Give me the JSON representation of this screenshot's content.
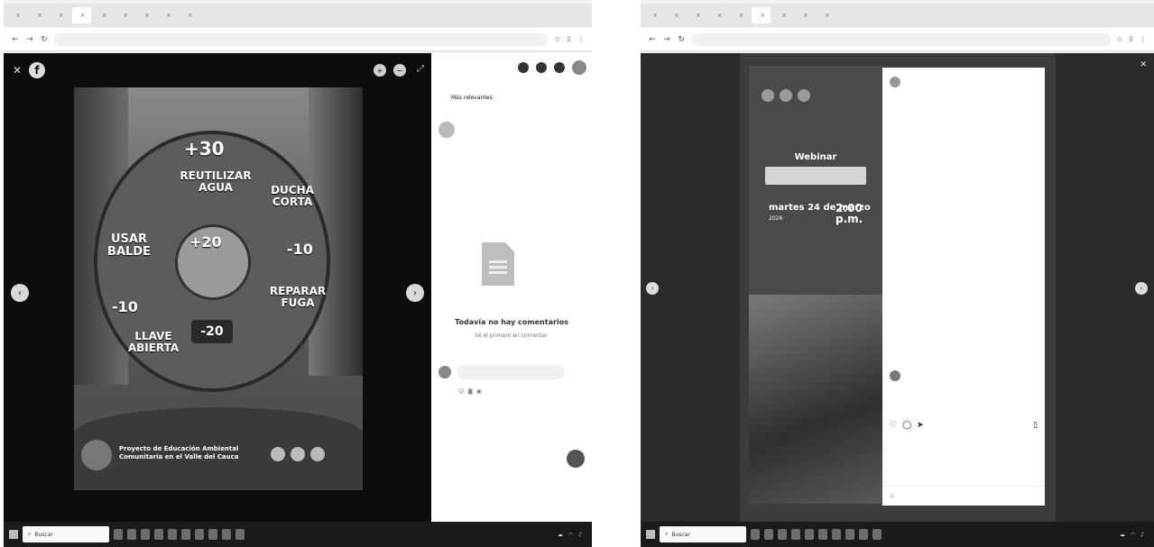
{
  "left": {
    "tabs": [
      "",
      "",
      "",
      "",
      "",
      "",
      "",
      "",
      ""
    ],
    "photo": {
      "segments": {
        "plus30": "+30",
        "reutilizar": "REUTILIZAR AGUA",
        "ducha": "DUCHA CORTA",
        "usar": "USAR BALDE",
        "plus20": "+20",
        "minus10a": "-10",
        "reparar": "REPARAR FUGA",
        "minus10b": "-10",
        "llave": "LLAVE ABIERTA",
        "minus20": "-20"
      },
      "banner_text": "Proyecto de Educación Ambiental Comunitaria en el Valle del Cauca"
    },
    "panel": {
      "tab_second": "Más relevantes",
      "no_comments": "Todavía no hay comentarios",
      "be_first": "Sé el primero en comentar."
    },
    "taskbar": {
      "search_label": "Buscar"
    }
  },
  "right": {
    "tabs": [
      "",
      "",
      "",
      "",
      "",
      "",
      "",
      "",
      ""
    ],
    "poster": {
      "title": "Webinar",
      "date": "martes 24 de marzo",
      "year": "2026",
      "time": "2:00 p.m."
    },
    "taskbar": {
      "search_label": "Buscar"
    }
  }
}
